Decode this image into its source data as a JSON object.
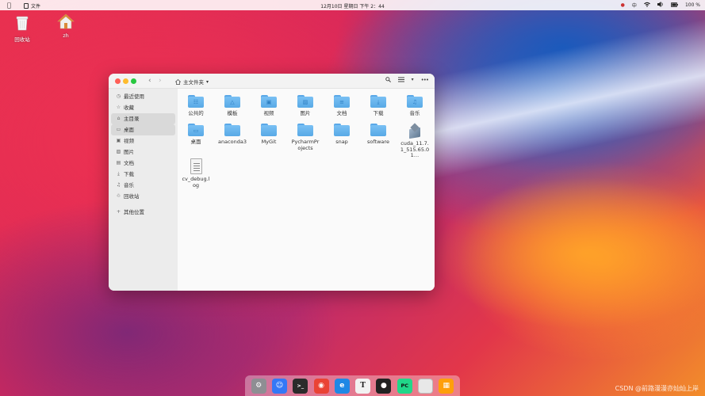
{
  "topbar": {
    "app_name": "文件",
    "clock": "12月10日 星期日  下午 2：44",
    "input_method": "中",
    "battery": "100 %"
  },
  "desktop": {
    "icons": [
      {
        "label": "回收站",
        "icon": "trash-icon"
      },
      {
        "label": "zh",
        "icon": "home-folder-icon"
      }
    ]
  },
  "window": {
    "path_label": "主文件夹",
    "sidebar": [
      {
        "label": "最近使用",
        "icon": "clock-icon"
      },
      {
        "label": "收藏",
        "icon": "star-icon"
      },
      {
        "label": "主目录",
        "icon": "home-icon",
        "active": true
      },
      {
        "label": "桌面",
        "icon": "desktop-icon",
        "active": true
      },
      {
        "label": "视频",
        "icon": "video-icon"
      },
      {
        "label": "图片",
        "icon": "image-icon"
      },
      {
        "label": "文档",
        "icon": "document-icon"
      },
      {
        "label": "下载",
        "icon": "download-icon"
      },
      {
        "label": "音乐",
        "icon": "music-icon"
      },
      {
        "label": "回收站",
        "icon": "trash-icon"
      },
      {
        "label": "其他位置",
        "icon": "plus-icon"
      }
    ],
    "items": [
      {
        "label": "公共的",
        "kind": "folder",
        "glyph": "public"
      },
      {
        "label": "模板",
        "kind": "folder",
        "glyph": "template"
      },
      {
        "label": "视频",
        "kind": "folder",
        "glyph": "video"
      },
      {
        "label": "图片",
        "kind": "folder",
        "glyph": "image"
      },
      {
        "label": "文档",
        "kind": "folder",
        "glyph": "document"
      },
      {
        "label": "下载",
        "kind": "folder",
        "glyph": "download"
      },
      {
        "label": "音乐",
        "kind": "folder",
        "glyph": "music"
      },
      {
        "label": "桌面",
        "kind": "folder",
        "glyph": "desktop"
      },
      {
        "label": "anaconda3",
        "kind": "folder",
        "glyph": ""
      },
      {
        "label": "MyGit",
        "kind": "folder",
        "glyph": ""
      },
      {
        "label": "PycharmProjects",
        "kind": "folder",
        "glyph": ""
      },
      {
        "label": "snap",
        "kind": "folder",
        "glyph": ""
      },
      {
        "label": "software",
        "kind": "folder",
        "glyph": ""
      },
      {
        "label": "cuda_11.7.1_515.65.01…",
        "kind": "package",
        "glyph": ""
      },
      {
        "label": "cv_debug.log",
        "kind": "file",
        "glyph": ""
      }
    ]
  },
  "dock": {
    "apps": [
      {
        "name": "settings-app",
        "color": "#8e8e93"
      },
      {
        "name": "finder-app",
        "color": "#3478f6"
      },
      {
        "name": "terminal-app",
        "color": "#2b2b2b"
      },
      {
        "name": "chrome-app",
        "color": "#ea4335"
      },
      {
        "name": "edge-app",
        "color": "#1e88e5"
      },
      {
        "name": "typora-app",
        "color": "#f2f2f2"
      },
      {
        "name": "qq-app",
        "color": "#222222"
      },
      {
        "name": "pycharm-app",
        "color": "#21d789"
      },
      {
        "name": "trash-app",
        "color": "#e8e8e8"
      },
      {
        "name": "launcher-app",
        "color": "#ff9f0a"
      }
    ]
  },
  "watermark": "CSDN @前路漫漫亦灿灿上岸"
}
